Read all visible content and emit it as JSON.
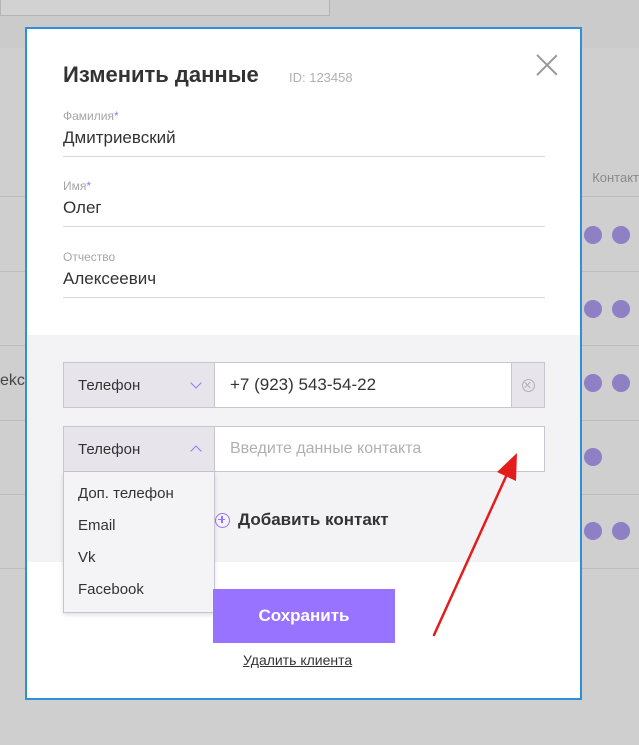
{
  "background": {
    "contacts_header": "Контакт",
    "row_text_fragment": "ekca"
  },
  "modal": {
    "title": "Изменить данные",
    "client_id": "ID: 123458",
    "fields": [
      {
        "label": "Фамилия",
        "required_mark": "*",
        "value": "Дмитриевский"
      },
      {
        "label": "Имя",
        "required_mark": "*",
        "value": "Олег"
      },
      {
        "label": "Отчество",
        "required_mark": "",
        "value": "Алексеевич"
      }
    ],
    "contacts": [
      {
        "type": "Телефон",
        "value": "+7 (923) 543-54-22",
        "placeholder": ""
      },
      {
        "type": "Телефон",
        "value": "",
        "placeholder": "Введите данные контакта"
      }
    ],
    "dropdown_options": [
      "Доп. телефон",
      "Email",
      "Vk",
      "Facebook"
    ],
    "add_contact_label": "Добавить контакт",
    "save_label": "Сохранить",
    "delete_client_label": "Удалить клиента"
  },
  "colors": {
    "accent": "#9873ff",
    "modal_border": "#2f8fdc",
    "annotation_arrow": "#e51c1c"
  }
}
